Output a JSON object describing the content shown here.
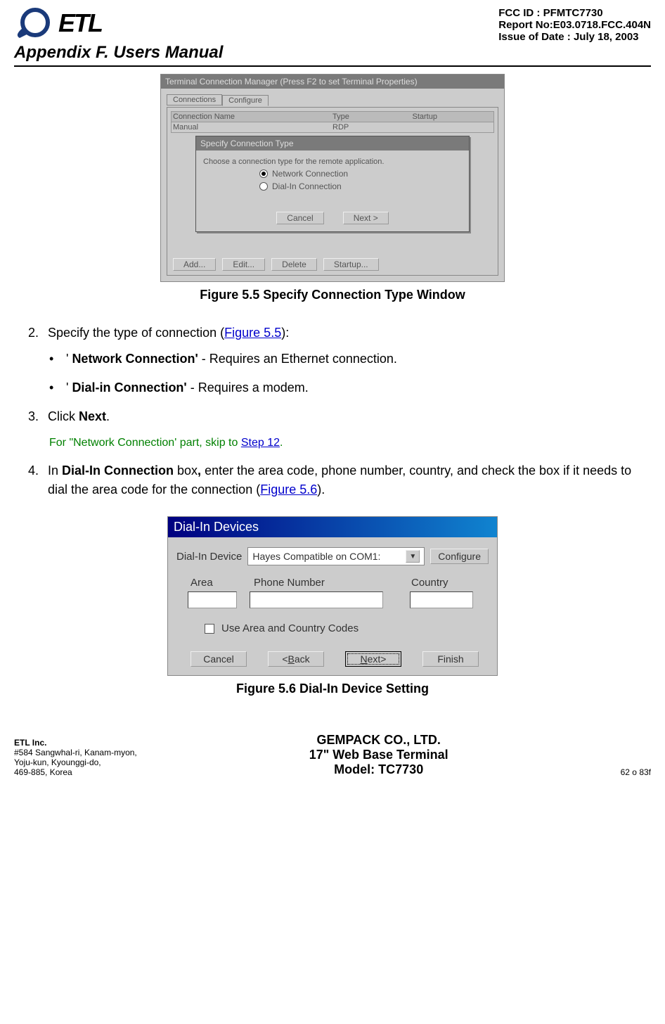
{
  "header": {
    "fcc_id": "FCC ID : PFMTC7730",
    "report_no": "Report No:E03.0718.FCC.404N",
    "issue_date": "Issue of Date : July 18, 2003",
    "logo_text": "ETL"
  },
  "appendix_title": "Appendix F.  Users Manual",
  "figure55": {
    "manager_title": "Terminal Connection Manager (Press F2 to set Terminal Properties)",
    "tab_connections": "Connections",
    "tab_configure": "Configure",
    "col_name": "Connection Name",
    "col_type": "Type",
    "col_startup": "Startup",
    "row_name": "Manual",
    "row_type": "RDP",
    "dialog_title": "Specify Connection Type",
    "dialog_instruction": "Choose a connection type for the remote application.",
    "radio_network": "Network Connection",
    "radio_dialin": "Dial-In Connection",
    "btn_cancel": "Cancel",
    "btn_next": "Next >",
    "btn_add": "Add...",
    "btn_edit": "Edit...",
    "btn_delete": "Delete",
    "btn_startup": "Startup...",
    "caption": "Figure 5.5    Specify Connection Type Window"
  },
  "steps": {
    "s2_pre": "Specify the type of connection (",
    "s2_link": "Figure 5.5",
    "s2_post": "):",
    "bullet1_bold": "Network Connection'",
    "bullet1_rest": "  - Requires an Ethernet connection.",
    "bullet2_bold": "Dial-in Connection'",
    "bullet2_rest": "  - Requires a modem.",
    "s3_pre": "Click ",
    "s3_bold": "Next",
    "s3_post": ".",
    "note_pre": "For \"Network Connection'  part, skip to ",
    "note_link": "Step 12",
    "note_post": ".",
    "s4_pre": "In ",
    "s4_bold": "Dial-In Connection",
    "s4_mid1": " box",
    "s4_bold2": ",",
    "s4_mid2": " enter the area code, phone number, country, and check the box if it needs to dial the area code for the connection (",
    "s4_link": "Figure 5.6",
    "s4_post": ")."
  },
  "figure56": {
    "window_title": "Dial-In Devices",
    "label_device": "Dial-In Device",
    "select_value": "Hayes Compatible on COM1:",
    "btn_configure": "Configure",
    "label_area": "Area",
    "label_phone": "Phone Number",
    "label_country": "Country",
    "check_label": "Use Area and Country Codes",
    "btn_cancel": "Cancel",
    "btn_back": "<Back",
    "btn_next": "Next>",
    "btn_finish": "Finish",
    "caption": "Figure 5.6    Dial-In Device Setting"
  },
  "footer": {
    "company": "ETL Inc.",
    "addr1": "#584 Sangwhal-ri, Kanam-myon,",
    "addr2": "Yoju-kun, Kyounggi-do,",
    "addr3": "469-885, Korea",
    "center1": "GEMPACK CO., LTD.",
    "center2": "17\" Web Base Terminal",
    "center3": "Model: TC7730",
    "page": "62 o 83f"
  }
}
